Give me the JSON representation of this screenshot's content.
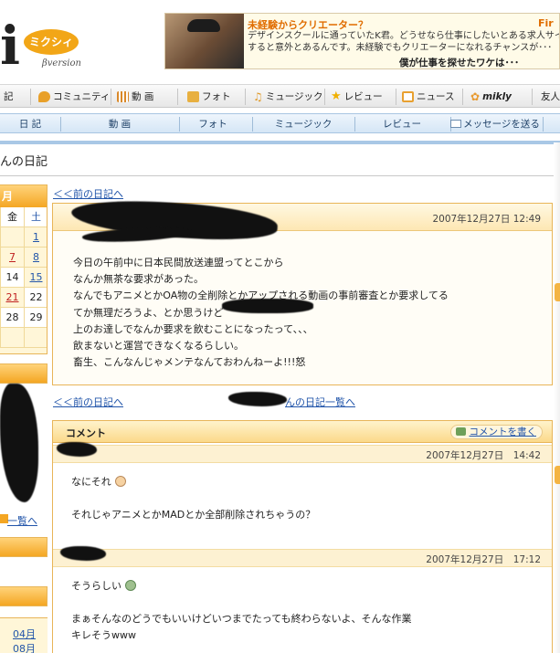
{
  "header": {
    "logo_letter": "i",
    "logo_badge": "ミクシィ",
    "logo_version": "βversion"
  },
  "ad": {
    "title": "未経験からクリエーター？",
    "corner": "Fir",
    "line1": "デザインスクールに通っていたK君。どうせなら仕事にしたいとある求人サイトで仕事",
    "line2": "すると意外とあるんです。未経験でもクリエーターになれるチャンスが･･･",
    "tagline": "僕が仕事を探せたワケは･･･"
  },
  "main_nav": [
    {
      "label": "記",
      "icon": ""
    },
    {
      "label": "コミュニティ",
      "icon": "speech-bubble-icon",
      "color": "#e8a02a"
    },
    {
      "label": "動 画",
      "icon": "film-icon",
      "color": "#d9892a"
    },
    {
      "label": "フォト",
      "icon": "folder-icon",
      "color": "#e8b040"
    },
    {
      "label": "ミュージック",
      "icon": "music-note-icon",
      "color": "#e09a2a"
    },
    {
      "label": "レビュー",
      "icon": "star-icon",
      "color": "#f0b000"
    },
    {
      "label": "ニュース",
      "icon": "news-icon",
      "color": "#e8a030"
    },
    {
      "label": "mikly",
      "icon": "flower-icon",
      "color": "#e89a30"
    },
    {
      "label": "友人",
      "icon": "",
      "color": ""
    }
  ],
  "sub_nav": [
    {
      "label": "日 記"
    },
    {
      "label": "動 画"
    },
    {
      "label": "フォト"
    },
    {
      "label": "ミュージック"
    },
    {
      "label": "レビュー"
    },
    {
      "label": "メッセージを送る"
    }
  ],
  "page": {
    "title": "んの日記"
  },
  "calendar": {
    "month_suffix": "月",
    "headers": [
      "金",
      "土"
    ],
    "rows": [
      [
        "",
        "1"
      ],
      [
        "7",
        "8"
      ],
      [
        "14",
        "15"
      ],
      [
        "21",
        "22"
      ],
      [
        "28",
        "29"
      ],
      [
        "",
        ""
      ]
    ]
  },
  "sidebar": {
    "list_link": "一覧へ",
    "months": [
      "04月",
      "08月"
    ]
  },
  "diary": {
    "prev_link": "＜＜前の日記へ",
    "date": "2007年12月27日 12:49",
    "lines": [
      "今日の午前中に日本民間放送連盟ってとこから",
      "なんか無茶な要求があった。",
      "なんでもアニメとかOA物の全削除とかアップされる動画の事前審査とか要求してる",
      "てか無理だろうよ、とか思うけど",
      "上のお達しでなんか要求を飲むことになったって、、、",
      "飲まないと運営できなくなるらしい。",
      "畜生、こんなんじゃメンテなんておわんねーよ!!!怒"
    ],
    "prev_link_bottom": "＜＜前の日記へ",
    "list_link": "んの日記一覧へ"
  },
  "comments": {
    "title": "コメント",
    "write_label": "コメントを書く",
    "items": [
      {
        "date": "2007年12月27日　14:42",
        "line1": "なにそれ",
        "line2": "それじゃアニメとかMADとか全部削除されちゃうの？"
      },
      {
        "date": "2007年12月27日　17:12",
        "line1": "そうらしい",
        "line2": "まぁそんなのどうでもいいけどいつまでたっても終わらないよ、そんな作業",
        "line3": "キレそうwww"
      }
    ]
  }
}
